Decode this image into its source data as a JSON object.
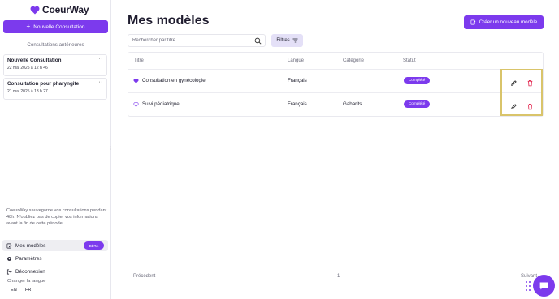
{
  "app": {
    "name": "CoeurWay",
    "brand_color": "#7c3aed"
  },
  "sidebar": {
    "new_consultation_label": "Nouvelle Consultation",
    "previous_title": "Consultations antérieures",
    "consultations": [
      {
        "title": "Nouvelle Consultation",
        "date": "22 mai 2025 à 12 h 46"
      },
      {
        "title": "Consultation pour pharyngite",
        "date": "21 mai 2025 à 13 h 27"
      }
    ],
    "note": "CoeurWay sauvegarde vos consultations pendant 48h. N'oubliez pas de copier vos informations avant la fin de cette période.",
    "menu": {
      "models_label": "Mes modèles",
      "beta_label": "BÊTA",
      "settings_label": "Paramètres",
      "logout_label": "Déconnexion"
    },
    "language": {
      "label": "Changer la langue",
      "options": [
        "EN",
        "FR"
      ]
    }
  },
  "main": {
    "title": "Mes modèles",
    "create_button_label": "Créer un nouveau modèle",
    "search": {
      "placeholder": "Rechercher par titre",
      "value": ""
    },
    "filters_label": "Filtres",
    "table": {
      "columns": [
        "Titre",
        "Langue",
        "Catégorie",
        "Statut"
      ],
      "rows": [
        {
          "title": "Consultation en gynécologie",
          "favorite": true,
          "language": "Français",
          "category": "",
          "status": "Complété"
        },
        {
          "title": "Suivi pédiatrique",
          "favorite": false,
          "language": "Français",
          "category": "Gabarits",
          "status": "Complété"
        }
      ]
    },
    "pagination": {
      "prev_label": "Précédent",
      "page": "1",
      "next_label": "Suivant"
    }
  }
}
